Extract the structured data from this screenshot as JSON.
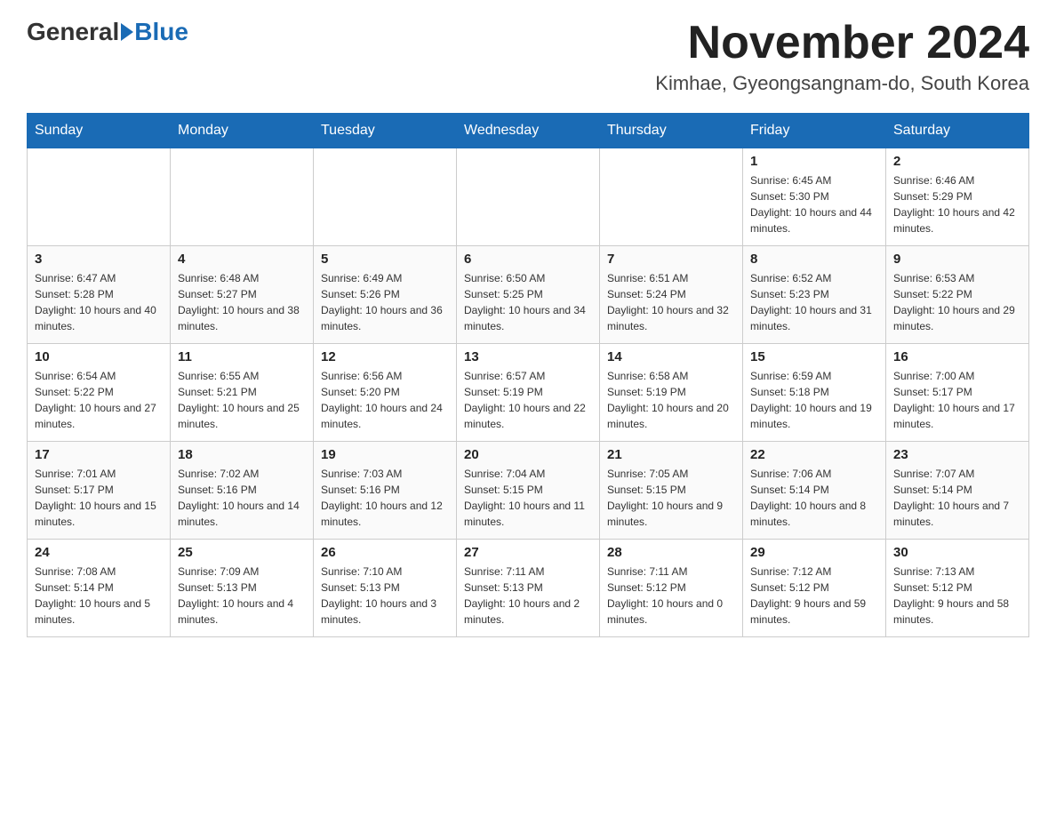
{
  "header": {
    "logo_general": "General",
    "logo_blue": "Blue",
    "month_title": "November 2024",
    "location": "Kimhae, Gyeongsangnam-do, South Korea"
  },
  "days_of_week": [
    "Sunday",
    "Monday",
    "Tuesday",
    "Wednesday",
    "Thursday",
    "Friday",
    "Saturday"
  ],
  "weeks": [
    [
      {
        "day": "",
        "info": ""
      },
      {
        "day": "",
        "info": ""
      },
      {
        "day": "",
        "info": ""
      },
      {
        "day": "",
        "info": ""
      },
      {
        "day": "",
        "info": ""
      },
      {
        "day": "1",
        "info": "Sunrise: 6:45 AM\nSunset: 5:30 PM\nDaylight: 10 hours and 44 minutes."
      },
      {
        "day": "2",
        "info": "Sunrise: 6:46 AM\nSunset: 5:29 PM\nDaylight: 10 hours and 42 minutes."
      }
    ],
    [
      {
        "day": "3",
        "info": "Sunrise: 6:47 AM\nSunset: 5:28 PM\nDaylight: 10 hours and 40 minutes."
      },
      {
        "day": "4",
        "info": "Sunrise: 6:48 AM\nSunset: 5:27 PM\nDaylight: 10 hours and 38 minutes."
      },
      {
        "day": "5",
        "info": "Sunrise: 6:49 AM\nSunset: 5:26 PM\nDaylight: 10 hours and 36 minutes."
      },
      {
        "day": "6",
        "info": "Sunrise: 6:50 AM\nSunset: 5:25 PM\nDaylight: 10 hours and 34 minutes."
      },
      {
        "day": "7",
        "info": "Sunrise: 6:51 AM\nSunset: 5:24 PM\nDaylight: 10 hours and 32 minutes."
      },
      {
        "day": "8",
        "info": "Sunrise: 6:52 AM\nSunset: 5:23 PM\nDaylight: 10 hours and 31 minutes."
      },
      {
        "day": "9",
        "info": "Sunrise: 6:53 AM\nSunset: 5:22 PM\nDaylight: 10 hours and 29 minutes."
      }
    ],
    [
      {
        "day": "10",
        "info": "Sunrise: 6:54 AM\nSunset: 5:22 PM\nDaylight: 10 hours and 27 minutes."
      },
      {
        "day": "11",
        "info": "Sunrise: 6:55 AM\nSunset: 5:21 PM\nDaylight: 10 hours and 25 minutes."
      },
      {
        "day": "12",
        "info": "Sunrise: 6:56 AM\nSunset: 5:20 PM\nDaylight: 10 hours and 24 minutes."
      },
      {
        "day": "13",
        "info": "Sunrise: 6:57 AM\nSunset: 5:19 PM\nDaylight: 10 hours and 22 minutes."
      },
      {
        "day": "14",
        "info": "Sunrise: 6:58 AM\nSunset: 5:19 PM\nDaylight: 10 hours and 20 minutes."
      },
      {
        "day": "15",
        "info": "Sunrise: 6:59 AM\nSunset: 5:18 PM\nDaylight: 10 hours and 19 minutes."
      },
      {
        "day": "16",
        "info": "Sunrise: 7:00 AM\nSunset: 5:17 PM\nDaylight: 10 hours and 17 minutes."
      }
    ],
    [
      {
        "day": "17",
        "info": "Sunrise: 7:01 AM\nSunset: 5:17 PM\nDaylight: 10 hours and 15 minutes."
      },
      {
        "day": "18",
        "info": "Sunrise: 7:02 AM\nSunset: 5:16 PM\nDaylight: 10 hours and 14 minutes."
      },
      {
        "day": "19",
        "info": "Sunrise: 7:03 AM\nSunset: 5:16 PM\nDaylight: 10 hours and 12 minutes."
      },
      {
        "day": "20",
        "info": "Sunrise: 7:04 AM\nSunset: 5:15 PM\nDaylight: 10 hours and 11 minutes."
      },
      {
        "day": "21",
        "info": "Sunrise: 7:05 AM\nSunset: 5:15 PM\nDaylight: 10 hours and 9 minutes."
      },
      {
        "day": "22",
        "info": "Sunrise: 7:06 AM\nSunset: 5:14 PM\nDaylight: 10 hours and 8 minutes."
      },
      {
        "day": "23",
        "info": "Sunrise: 7:07 AM\nSunset: 5:14 PM\nDaylight: 10 hours and 7 minutes."
      }
    ],
    [
      {
        "day": "24",
        "info": "Sunrise: 7:08 AM\nSunset: 5:14 PM\nDaylight: 10 hours and 5 minutes."
      },
      {
        "day": "25",
        "info": "Sunrise: 7:09 AM\nSunset: 5:13 PM\nDaylight: 10 hours and 4 minutes."
      },
      {
        "day": "26",
        "info": "Sunrise: 7:10 AM\nSunset: 5:13 PM\nDaylight: 10 hours and 3 minutes."
      },
      {
        "day": "27",
        "info": "Sunrise: 7:11 AM\nSunset: 5:13 PM\nDaylight: 10 hours and 2 minutes."
      },
      {
        "day": "28",
        "info": "Sunrise: 7:11 AM\nSunset: 5:12 PM\nDaylight: 10 hours and 0 minutes."
      },
      {
        "day": "29",
        "info": "Sunrise: 7:12 AM\nSunset: 5:12 PM\nDaylight: 9 hours and 59 minutes."
      },
      {
        "day": "30",
        "info": "Sunrise: 7:13 AM\nSunset: 5:12 PM\nDaylight: 9 hours and 58 minutes."
      }
    ]
  ]
}
